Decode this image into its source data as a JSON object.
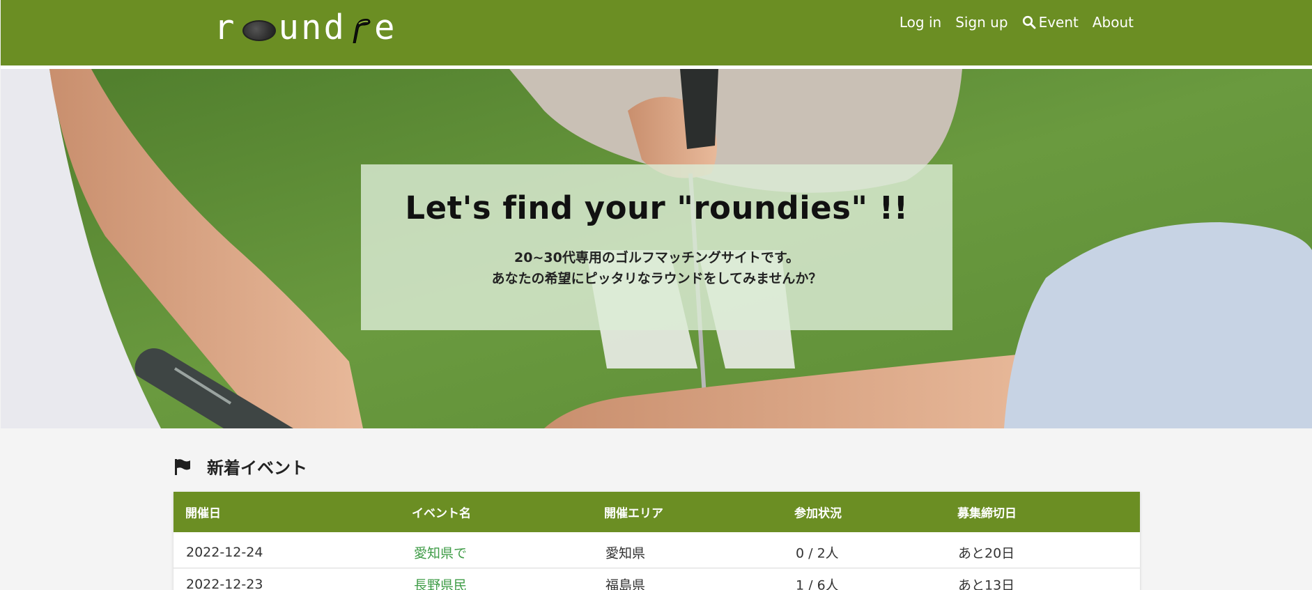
{
  "header": {
    "logo": {
      "text_before": "r",
      "text_middle": "und",
      "text_after": "e",
      "ball_icon": "golf-ball-icon",
      "club_icon": "golf-club-icon"
    },
    "nav": [
      {
        "label": "Log in"
      },
      {
        "label": "Sign up"
      },
      {
        "label": "Event",
        "icon": "search-icon"
      },
      {
        "label": "About"
      }
    ]
  },
  "hero": {
    "title": "Let's find your \"roundies\" !!",
    "subtitle_line1": "20~30代専用のゴルフマッチングサイトです。",
    "subtitle_line2": "あなたの希望にピッタリなラウンドをしてみませんか？"
  },
  "events": {
    "heading": "新着イベント",
    "heading_icon": "flag-icon",
    "columns": [
      "開催日",
      "イベント名",
      "開催エリア",
      "参加状況",
      "募集締切日"
    ],
    "rows": [
      {
        "date": "2022-12-24",
        "name": "愛知県で",
        "area": "愛知県",
        "status": "0 / 2人",
        "deadline": "あと20日"
      },
      {
        "date": "2022-12-23",
        "name": "長野県民",
        "area": "福島県",
        "status": "1 / 6人",
        "deadline": "あと13日"
      }
    ]
  },
  "colors": {
    "brand_green": "#6b8e23",
    "link_green": "#3f9c47",
    "page_bg": "#f4f4f4"
  }
}
